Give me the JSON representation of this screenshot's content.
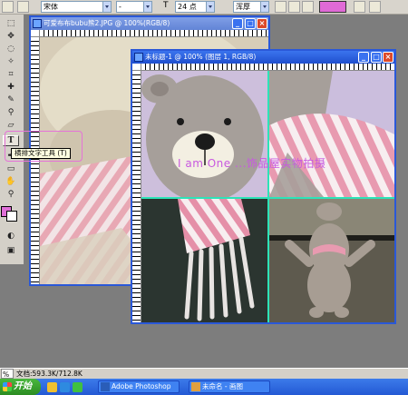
{
  "options_bar": {
    "font_family": "宋体",
    "font_style": "-",
    "font_size": "24 点",
    "aa_mode": "浑厚",
    "font_size_icon": "text-size-icon",
    "text_color": "#e06ad6"
  },
  "tooltip": {
    "text": "横排文字工具 (T)"
  },
  "window_back": {
    "title": "可爱布布bubu熊2.JPG @ 100%(RGB/8)"
  },
  "window_front": {
    "title": "未标题-1 @ 100% (图层 1, RGB/8)",
    "watermark": "I am One ...饰品屋实物拍摄"
  },
  "statusbar": {
    "zoom": "%",
    "doc_info": "文档:593.3K/712.8K"
  },
  "taskbar": {
    "start_label": "开始",
    "tasks": [
      {
        "label": "Adobe Photoshop"
      },
      {
        "label": "未命名 - 画图"
      }
    ]
  },
  "colors": {
    "title_active": "#1f4fce",
    "grid_line": "#2de3b8",
    "watermark": "#c858e0",
    "highlight_frame": "#e572d8"
  }
}
